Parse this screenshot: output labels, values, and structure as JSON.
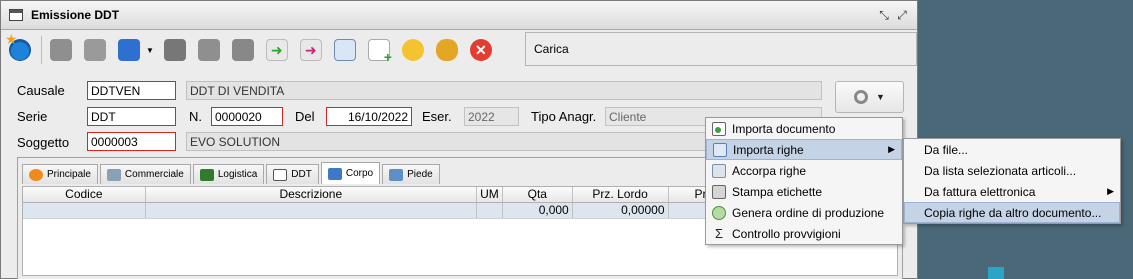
{
  "window": {
    "title": "Emissione DDT"
  },
  "toolbar": {
    "status_text": "Carica"
  },
  "form": {
    "causale": {
      "label": "Causale",
      "code": "DDTVEN",
      "description": "DDT DI VENDITA"
    },
    "serie": {
      "label": "Serie",
      "value": "DDT"
    },
    "numero": {
      "label": "N.",
      "value": "0000020"
    },
    "data": {
      "label": "Del",
      "value": "16/10/2022"
    },
    "esercizio": {
      "label": "Eser.",
      "value": "2022"
    },
    "tipo_anagrafica": {
      "label": "Tipo Anagr.",
      "value": "Cliente"
    },
    "soggetto": {
      "label": "Soggetto",
      "code": "0000003",
      "name": "EVO SOLUTION"
    }
  },
  "tabs": [
    {
      "label": "Principale"
    },
    {
      "label": "Commerciale"
    },
    {
      "label": "Logistica"
    },
    {
      "label": "DDT"
    },
    {
      "label": "Corpo"
    },
    {
      "label": "Piede"
    }
  ],
  "grid": {
    "columns": [
      "Codice",
      "Descrizione",
      "UM",
      "Qta",
      "Prz. Lordo",
      "Pr"
    ],
    "rows": [
      {
        "codice": "",
        "descrizione": "",
        "um": "",
        "qta": "0,000",
        "prz_lordo": "0,00000",
        "pr": ""
      }
    ]
  },
  "context_menu": {
    "items": [
      {
        "label": "Importa documento"
      },
      {
        "label": "Importa righe"
      },
      {
        "label": "Accorpa righe"
      },
      {
        "label": "Stampa etichette"
      },
      {
        "label": "Genera ordine di produzione"
      },
      {
        "label": "Controllo provvigioni"
      }
    ]
  },
  "submenu": {
    "items": [
      {
        "label": "Da file..."
      },
      {
        "label": "Da lista selezionata articoli..."
      },
      {
        "label": "Da fattura elettronica"
      },
      {
        "label": "Copia righe da altro documento..."
      }
    ]
  },
  "colors": {
    "required_border": "#dd2222",
    "menu_highlight": "#c5d3e6",
    "desktop": "#4a6878"
  }
}
